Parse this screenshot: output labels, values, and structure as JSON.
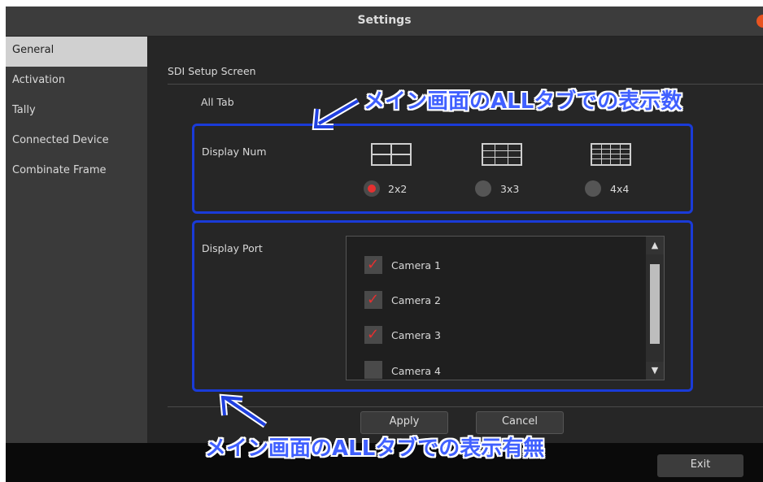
{
  "window": {
    "title": "Settings"
  },
  "sidebar": {
    "items": [
      {
        "label": "General",
        "active": true
      },
      {
        "label": "Activation",
        "active": false
      },
      {
        "label": "Tally",
        "active": false
      },
      {
        "label": "Connected Device",
        "active": false
      },
      {
        "label": "Combinate Frame",
        "active": false
      }
    ]
  },
  "main": {
    "section_title": "SDI Setup Screen",
    "tab_label": "All Tab",
    "display_num": {
      "label": "Display Num",
      "options": [
        {
          "label": "2x2",
          "selected": true,
          "icon": "grid-2x2-icon"
        },
        {
          "label": "3x3",
          "selected": false,
          "icon": "grid-3x3-icon"
        },
        {
          "label": "4x4",
          "selected": false,
          "icon": "grid-4x4-icon"
        }
      ]
    },
    "display_port": {
      "label": "Display Port",
      "cameras": [
        {
          "label": "Camera 1",
          "checked": true
        },
        {
          "label": "Camera 2",
          "checked": true
        },
        {
          "label": "Camera 3",
          "checked": true
        },
        {
          "label": "Camera 4",
          "checked": false
        }
      ]
    },
    "apply_label": "Apply",
    "cancel_label": "Cancel"
  },
  "bottom": {
    "exit_label": "Exit"
  },
  "annotations": {
    "top": "メイン画面のALLタブでの表示数",
    "bottom": "メイン画面のALLタブでの表示有無"
  },
  "colors": {
    "accent": "#e53030",
    "annotation": "#1a3bd8",
    "close": "#e95420"
  }
}
